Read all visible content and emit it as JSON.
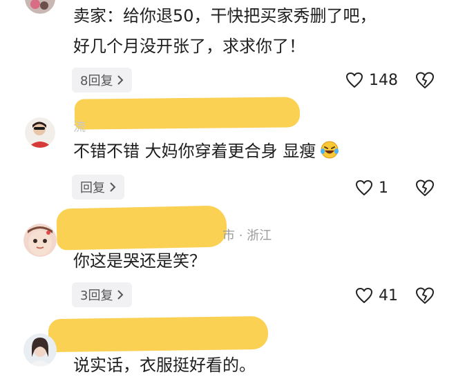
{
  "comments": [
    {
      "text_lines": [
        "卖家：给你退50，干快把买家秀删了吧，",
        "好几个月没开张了，求求你了！"
      ],
      "reply_label": "8回复",
      "likes": "148"
    },
    {
      "text_lines": [
        "不错不错 大妈你穿着更合身 显瘦"
      ],
      "reply_label": "回复",
      "likes": "1",
      "username_fragment": "流"
    },
    {
      "text_lines": [
        "你这是哭还是笑？"
      ],
      "reply_label": "3回复",
      "likes": "41",
      "location": "浙江",
      "location_prefix": "市 · "
    },
    {
      "text_lines": [
        "说实话，衣服挺好看的。"
      ]
    }
  ],
  "colors": {
    "redaction": "#fbd154",
    "chip_bg": "#f1f1f3",
    "meta_text": "#9b9b9b"
  },
  "icons": {
    "like": "heart-outline-icon",
    "dislike": "broken-heart-icon",
    "reply_chevron": "chevron-right-icon"
  }
}
